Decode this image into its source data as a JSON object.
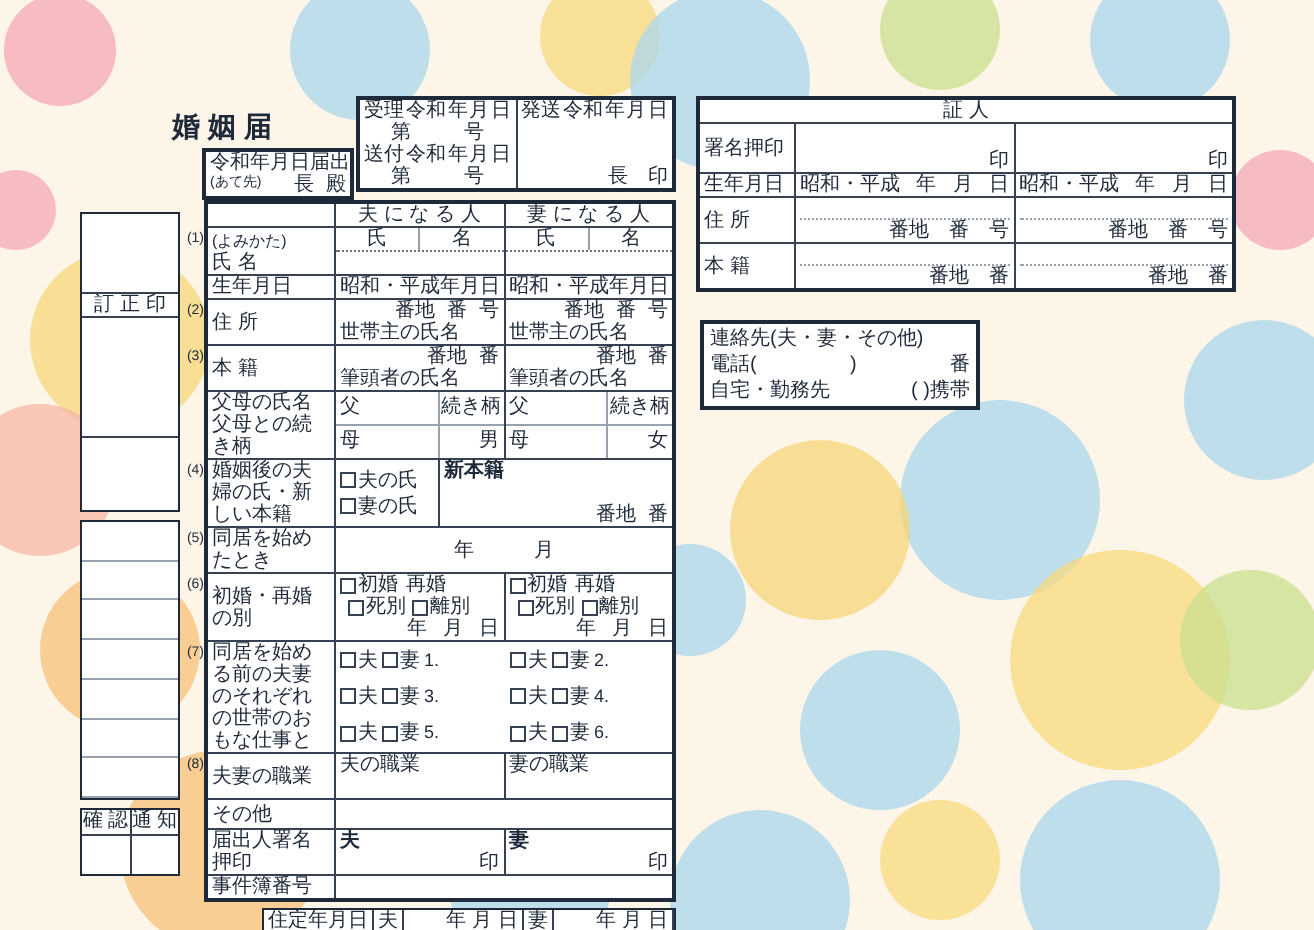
{
  "title": "婚 姻 届",
  "receipt": {
    "received": [
      "受理",
      "令和",
      "年",
      "月",
      "日"
    ],
    "received_no": [
      "第",
      "号"
    ],
    "sent": [
      "送付",
      "令和",
      "年",
      "月",
      "日"
    ],
    "sent_no": [
      "第",
      "号"
    ],
    "dispatched": [
      "発送",
      "令和",
      "年",
      "月",
      "日"
    ],
    "seal": [
      "長",
      "印"
    ]
  },
  "filing": {
    "date": [
      "令和",
      "年",
      "月",
      "日",
      "届出"
    ],
    "to_hint": "(あて先)",
    "to": [
      "長",
      "殿"
    ]
  },
  "sidebar": {
    "correction": "訂 正 印",
    "checks": [
      "確 認",
      "通 知"
    ]
  },
  "form": {
    "header": [
      "夫 に な る 人",
      "妻 に な る 人"
    ],
    "name": {
      "number": "(1)",
      "reading": "(よみかた)",
      "label": "氏 名",
      "parts": [
        [
          "氏",
          "名"
        ],
        [
          "氏",
          "名"
        ]
      ]
    },
    "birth": {
      "label": "生年月日",
      "values": [
        [
          "昭和・平成",
          "年",
          "月",
          "日"
        ],
        [
          "昭和・平成",
          "年",
          "月",
          "日"
        ]
      ]
    },
    "address": {
      "number": "(2)",
      "label": "住 所",
      "lot": [
        [
          "番地",
          "番",
          "号"
        ],
        [
          "番地",
          "番",
          "号"
        ]
      ],
      "owner": [
        "世帯主の氏名",
        "世帯主の氏名"
      ]
    },
    "domicile": {
      "number": "(3)",
      "label": "本 籍",
      "lot": [
        [
          "番地",
          "番"
        ],
        [
          "番地",
          "番"
        ]
      ],
      "owner": [
        "筆頭者の氏名",
        "筆頭者の氏名"
      ]
    },
    "parents": {
      "label": [
        "父母の氏名",
        "父母との続き柄"
      ],
      "rows": [
        {
          "father": "父",
          "mother": "母",
          "relation": "続き柄",
          "sex": "男"
        },
        {
          "father": "父",
          "mother": "母",
          "relation": "続き柄",
          "sex": "女"
        }
      ]
    },
    "new_surname": {
      "number": "(4)",
      "label": "婚姻後の夫婦の氏・新しい本籍",
      "options": [
        {
          "label": "夫の氏",
          "checked": false
        },
        {
          "label": "妻の氏",
          "checked": false
        }
      ],
      "domicile_label": "新本籍",
      "lot": [
        "番地",
        "番"
      ]
    },
    "cohabitation": {
      "number": "(5)",
      "label": "同居を始めたとき",
      "date": [
        "年",
        "月"
      ]
    },
    "marital": {
      "number": "(6)",
      "label": "初婚・再婚の別",
      "values": [
        {
          "first": {
            "label": "初婚",
            "checked": false
          },
          "second": "再婚",
          "reasons": [
            {
              "label": "死別",
              "checked": false
            },
            {
              "label": "離別",
              "checked": false
            }
          ],
          "date": [
            "年",
            "月",
            "日"
          ]
        },
        {
          "first": {
            "label": "初婚",
            "checked": false
          },
          "second": "再婚",
          "reasons": [
            {
              "label": "死別",
              "checked": false
            },
            {
              "label": "離別",
              "checked": false
            }
          ],
          "date": [
            "年",
            "月",
            "日"
          ]
        }
      ]
    },
    "household_work": {
      "number": "(7)",
      "label": "同居を始める前の夫妻のそれぞれの世帯のおもな仕事と",
      "items": [
        {
          "number": "1.",
          "husband": {
            "label": "夫",
            "checked": false
          },
          "wife": {
            "label": "妻",
            "checked": false
          }
        },
        {
          "number": "2.",
          "husband": {
            "label": "夫",
            "checked": false
          },
          "wife": {
            "label": "妻",
            "checked": false
          }
        },
        {
          "number": "3.",
          "husband": {
            "label": "夫",
            "checked": false
          },
          "wife": {
            "label": "妻",
            "checked": false
          }
        },
        {
          "number": "4.",
          "husband": {
            "label": "夫",
            "checked": false
          },
          "wife": {
            "label": "妻",
            "checked": false
          }
        },
        {
          "number": "5.",
          "husband": {
            "label": "夫",
            "checked": false
          },
          "wife": {
            "label": "妻",
            "checked": false
          }
        },
        {
          "number": "6.",
          "husband": {
            "label": "夫",
            "checked": false
          },
          "wife": {
            "label": "妻",
            "checked": false
          }
        }
      ]
    },
    "occupation": {
      "number": "(8)",
      "label": "夫妻の職業",
      "values": [
        "夫の職業",
        "妻の職業"
      ]
    },
    "other": {
      "label": "その他"
    },
    "signature": {
      "label": "届出人署名押印",
      "values": [
        {
          "who": "夫",
          "seal": "印"
        },
        {
          "who": "妻",
          "seal": "印"
        }
      ]
    },
    "case_number": {
      "label": "事件簿番号"
    },
    "residence": {
      "label": "住定年月日",
      "values": [
        {
          "who": "夫",
          "date": [
            "年",
            "月",
            "日"
          ]
        },
        {
          "who": "妻",
          "date": [
            "年",
            "月",
            "日"
          ]
        }
      ]
    }
  },
  "witness": {
    "title": "証 人",
    "signature_label": "署名押印",
    "seals": [
      "印",
      "印"
    ],
    "birth_label": "生年月日",
    "birth": [
      [
        "昭和・平成",
        "年",
        "月",
        "日"
      ],
      [
        "昭和・平成",
        "年",
        "月",
        "日"
      ]
    ],
    "address_label": "住 所",
    "address": [
      [
        "番地",
        "番",
        "号"
      ],
      [
        "番地",
        "番",
        "号"
      ]
    ],
    "domicile_label": "本 籍",
    "domicile": [
      [
        "番地",
        "番"
      ],
      [
        "番地",
        "番"
      ]
    ]
  },
  "contact": {
    "title": "連絡先(夫・妻・その他)",
    "phone": [
      "電話(",
      ")",
      "番"
    ],
    "place": [
      "自宅・勤務先",
      "( )携帯"
    ]
  }
}
